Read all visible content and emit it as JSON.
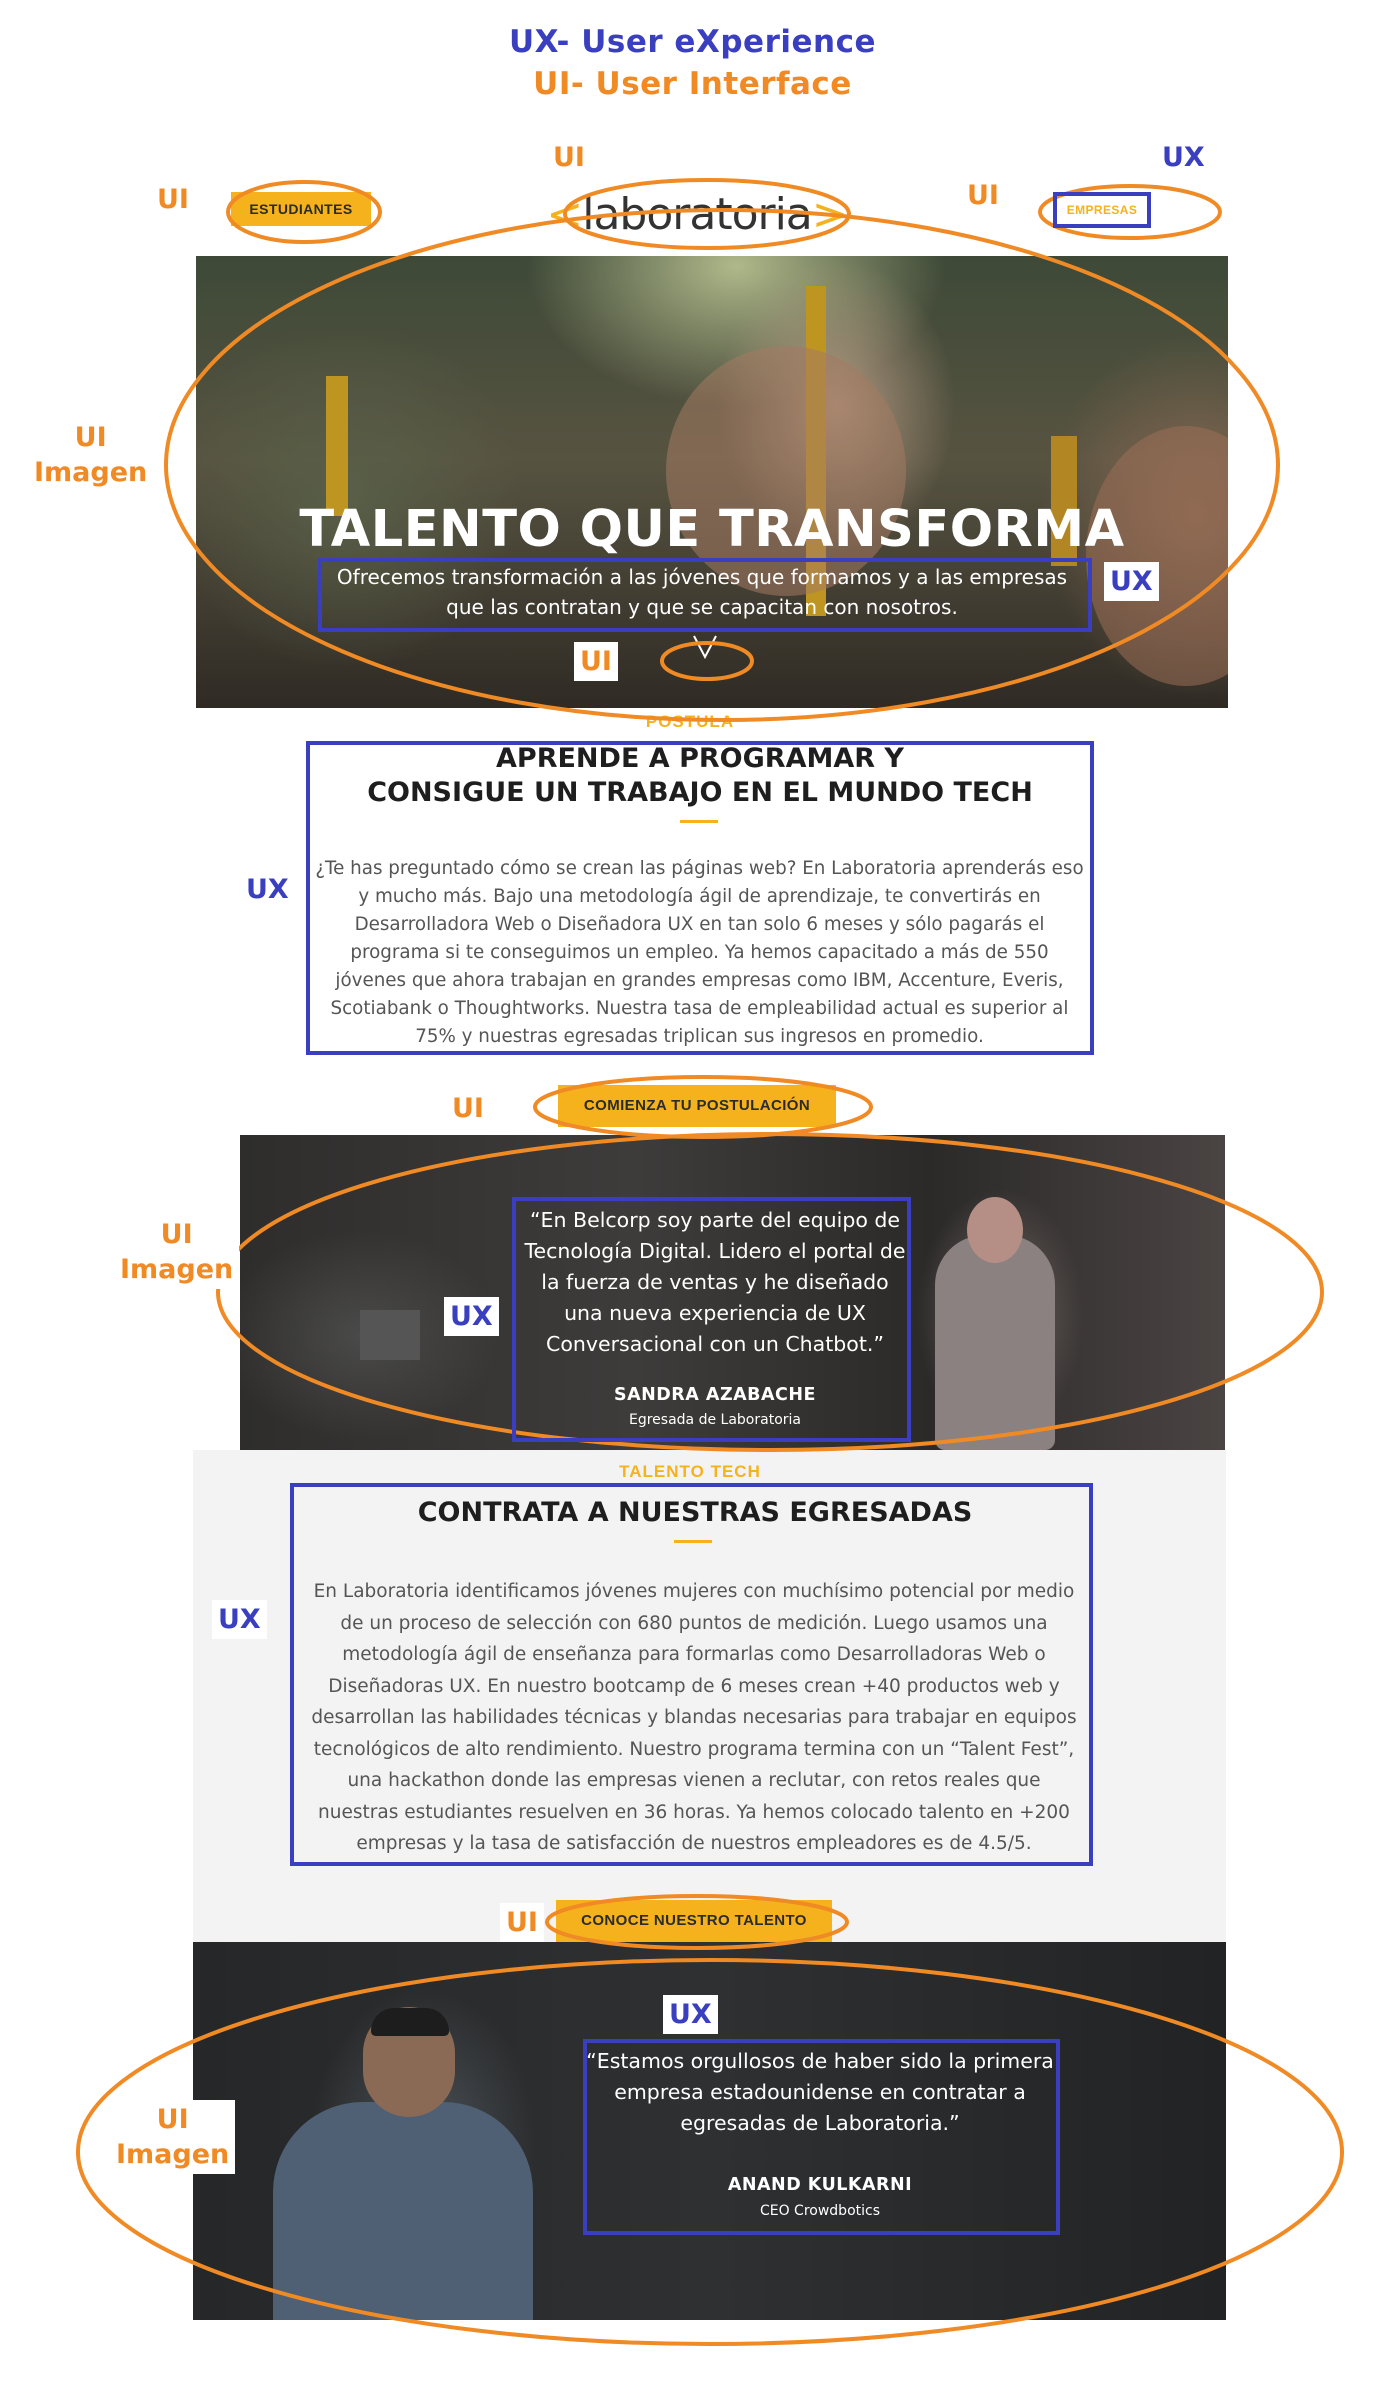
{
  "legend": {
    "ux": "UX- User eXperience",
    "ui": "UI- User Interface"
  },
  "annotations": {
    "ui": "UI",
    "ux": "UX",
    "imagen": "Imagen"
  },
  "header": {
    "students_button": "ESTUDIANTES",
    "logo_text": "laboratoria",
    "companies_button": "EMPRESAS"
  },
  "hero": {
    "title": "TALENTO QUE TRANSFORMA",
    "subtitle": "Ofrecemos transformación a las jóvenes que formamos y a las empresas que las contratan y que se capacitan con nosotros.",
    "scroll_icon": "chevron-down-icon"
  },
  "section_learn": {
    "eyebrow": "POSTULA",
    "title_line1": "APRENDE A PROGRAMAR Y",
    "title_line2": "CONSIGUE UN TRABAJO EN EL MUNDO TECH",
    "body": "¿Te has preguntado cómo se crean las páginas web? En Laboratoria aprenderás eso y mucho más. Bajo una metodología ágil de aprendizaje, te convertirás en Desarrolladora Web o Diseñadora UX en tan solo 6 meses y sólo pagarás el programa si te conseguimos un empleo. Ya hemos capacitado a más de 550 jóvenes que ahora trabajan en grandes empresas como IBM, Accenture, Everis, Scotiabank o Thoughtworks. Nuestra tasa de empleabilidad actual es superior al 75% y nuestras egresadas triplican sus ingresos en promedio.",
    "cta": "COMIENZA TU POSTULACIÓN"
  },
  "testimonial_1": {
    "quote": "“En Belcorp soy parte del equipo de Tecnología Digital. Lidero el portal de la fuerza de ventas y he diseñado una nueva experiencia de UX Conversacional con un Chatbot.”",
    "name": "SANDRA AZABACHE",
    "role": "Egresada de Laboratoria"
  },
  "section_hire": {
    "eyebrow": "TALENTO TECH",
    "title": "CONTRATA A NUESTRAS EGRESADAS",
    "body": "En Laboratoria identificamos jóvenes mujeres con muchísimo potencial por medio de un proceso de selección con 680 puntos de medición. Luego usamos una metodología ágil de enseñanza para formarlas como Desarrolladoras Web o Diseñadoras UX. En nuestro bootcamp de 6 meses crean +40 productos web y desarrollan las habilidades técnicas y blandas necesarias para trabajar en equipos tecnológicos de alto rendimiento. Nuestro programa termina con un “Talent Fest”, una hackathon donde las empresas vienen a reclutar, con retos reales que nuestras estudiantes resuelven en 36 horas. Ya hemos colocado talento en +200 empresas y la tasa de satisfacción de nuestros empleadores es de 4.5/5.",
    "cta": "CONOCE NUESTRO TALENTO"
  },
  "testimonial_2": {
    "quote": "“Estamos orgullosos de haber sido la primera empresa estadounidense en contratar a egresadas de Laboratoria.”",
    "name": "ANAND KULKARNI",
    "role": "CEO Crowdbotics"
  },
  "colors": {
    "ux_annotation": "#3a3fc0",
    "ui_annotation": "#f08a24",
    "brand_yellow": "#f6b21d"
  }
}
